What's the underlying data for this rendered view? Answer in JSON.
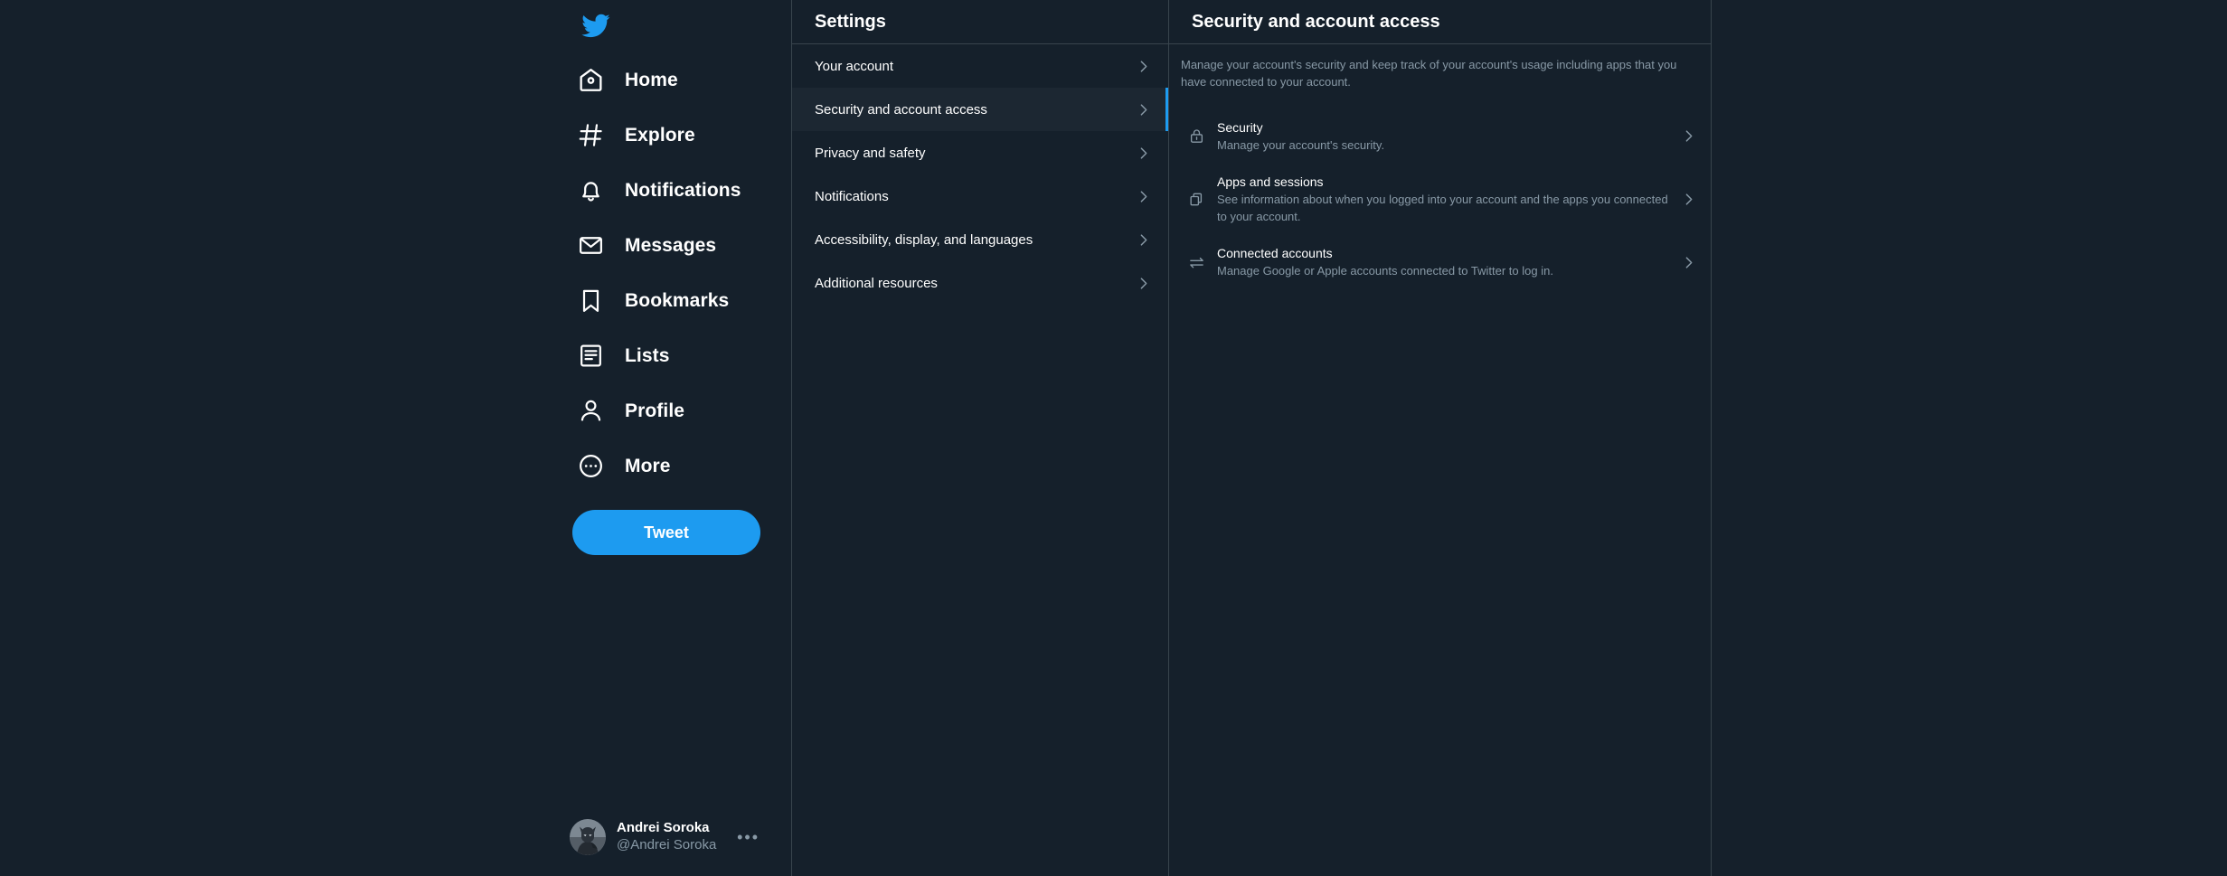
{
  "theme": {
    "background": "#15202b",
    "border": "#38444d",
    "accent": "#1d9bf0",
    "muted_text": "#8899a6",
    "selected_row_bg": "#1c2732",
    "primary_text": "#ffffff"
  },
  "sidebar": {
    "logo_name": "twitter-bird-logo",
    "items": [
      {
        "label": "Home",
        "icon": "home-icon"
      },
      {
        "label": "Explore",
        "icon": "hash-icon"
      },
      {
        "label": "Notifications",
        "icon": "bell-icon"
      },
      {
        "label": "Messages",
        "icon": "envelope-icon"
      },
      {
        "label": "Bookmarks",
        "icon": "bookmark-icon"
      },
      {
        "label": "Lists",
        "icon": "list-icon"
      },
      {
        "label": "Profile",
        "icon": "person-icon"
      },
      {
        "label": "More",
        "icon": "more-circle-icon"
      }
    ],
    "tweet_button_label": "Tweet",
    "account": {
      "name": "Andrei Soroka",
      "handle": "@Andrei Soroka",
      "more_glyph": "•••",
      "avatar_name": "batman-avatar"
    }
  },
  "settings": {
    "header": "Settings",
    "rows": [
      {
        "label": "Your account",
        "selected": false
      },
      {
        "label": "Security and account access",
        "selected": true
      },
      {
        "label": "Privacy and safety",
        "selected": false
      },
      {
        "label": "Notifications",
        "selected": false
      },
      {
        "label": "Accessibility, display, and languages",
        "selected": false
      },
      {
        "label": "Additional resources",
        "selected": false
      }
    ]
  },
  "detail": {
    "header": "Security and account access",
    "description": "Manage your account's security and keep track of your account's usage including apps that you have connected to your account.",
    "rows": [
      {
        "title": "Security",
        "subtitle": "Manage your account's security.",
        "icon": "lock-icon"
      },
      {
        "title": "Apps and sessions",
        "subtitle": "See information about when you logged into your account and the apps you connected to your account.",
        "icon": "copy-layers-icon"
      },
      {
        "title": "Connected accounts",
        "subtitle": "Manage Google or Apple accounts connected to Twitter to log in.",
        "icon": "swap-arrows-icon"
      }
    ]
  }
}
